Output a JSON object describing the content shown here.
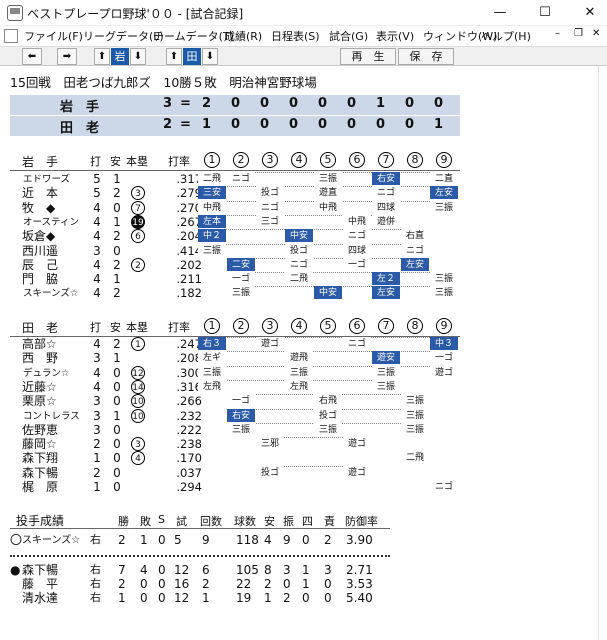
{
  "window": {
    "title": "ベストプレープロ野球'００ - [試合記録]",
    "controls": [
      "—",
      "☐",
      "✕"
    ]
  },
  "menu": [
    "ファイル(F)",
    "リーグデータ(L)",
    "チームデータ(T)",
    "成績(R)",
    "日程表(S)",
    "試合(G)",
    "表示(V)",
    "ウィンドウ(W)",
    "ヘルプ(H)"
  ],
  "toolbar": {
    "left": "⬅",
    "right": "➡",
    "home_up": "⬆",
    "home": "岩",
    "home_down": "⬇",
    "away_up": "⬆",
    "away": "田",
    "away_down": "⬇",
    "replay": "再　生",
    "save": "保　存"
  },
  "game": {
    "info": "15回戦　田老つば九郎ズ　10勝５敗　明治神宮野球場"
  },
  "scoreboard": [
    {
      "team": "岩　手",
      "runs": "3",
      "eq": "=",
      "innings": [
        "2",
        "0",
        "0",
        "0",
        "0",
        "0",
        "1",
        "0",
        "0"
      ]
    },
    {
      "team": "田　老",
      "runs": "2",
      "eq": "=",
      "innings": [
        "1",
        "0",
        "0",
        "0",
        "0",
        "0",
        "0",
        "0",
        "1"
      ]
    }
  ],
  "batting_headers": {
    "at_bat": "打",
    "hits": "安",
    "hr": "本塁",
    "avg": "打率",
    "innings": [
      "1",
      "2",
      "3",
      "4",
      "5",
      "6",
      "7",
      "8",
      "9"
    ]
  },
  "home_team": "岩　手",
  "home_batters": [
    {
      "name": "エドワーズ",
      "ab": "5",
      "h": "1",
      "hr": "",
      "avg": ".317",
      "ib": [
        [
          "二飛",
          0
        ],
        [
          "ニゴ",
          0
        ],
        [
          "",
          0
        ],
        [
          "",
          0
        ],
        [
          "三振",
          0
        ],
        [
          "",
          0
        ],
        [
          "右安",
          1
        ],
        [
          "",
          0
        ],
        [
          "二直",
          0
        ]
      ]
    },
    {
      "name": "近　本",
      "ab": "5",
      "h": "2",
      "hr": "3",
      "avg": ".279",
      "ib": [
        [
          "三安",
          1
        ],
        [
          "",
          0
        ],
        [
          "投ゴ",
          0
        ],
        [
          "",
          0
        ],
        [
          "遊直",
          0
        ],
        [
          "",
          0
        ],
        [
          "ニゴ",
          0
        ],
        [
          "",
          0
        ],
        [
          "左安",
          1
        ]
      ]
    },
    {
      "name": "牧　◆",
      "ab": "4",
      "h": "0",
      "hr": "7",
      "avg": ".270",
      "ib": [
        [
          "中飛",
          0
        ],
        [
          "",
          0
        ],
        [
          "ニゴ",
          0
        ],
        [
          "",
          0
        ],
        [
          "中飛",
          0
        ],
        [
          "",
          0
        ],
        [
          "四球",
          0
        ],
        [
          "",
          0
        ],
        [
          "三振",
          0
        ]
      ]
    },
    {
      "name": "オースティン",
      "ab": "4",
      "h": "1",
      "hr": "19",
      "hrsel": true,
      "avg": ".267",
      "ib": [
        [
          "左本",
          1
        ],
        [
          "",
          0
        ],
        [
          "三ゴ",
          0
        ],
        [
          "",
          0
        ],
        [
          "",
          0
        ],
        [
          "中飛",
          0
        ],
        [
          "遊併",
          0
        ],
        [
          "",
          0
        ],
        [
          "",
          0
        ]
      ]
    },
    {
      "name": "坂倉◆",
      "ab": "4",
      "h": "2",
      "hr": "6",
      "avg": ".204",
      "ib": [
        [
          "中２",
          1
        ],
        [
          "",
          0
        ],
        [
          "",
          0
        ],
        [
          "中安",
          1
        ],
        [
          "",
          0
        ],
        [
          "ニゴ",
          0
        ],
        [
          "",
          0
        ],
        [
          "右直",
          0
        ],
        [
          "",
          0
        ]
      ]
    },
    {
      "name": "西川遥",
      "ab": "3",
      "h": "0",
      "hr": "",
      "avg": ".414",
      "ib": [
        [
          "三振",
          0
        ],
        [
          "",
          0
        ],
        [
          "",
          0
        ],
        [
          "投ゴ",
          0
        ],
        [
          "",
          0
        ],
        [
          "四球",
          0
        ],
        [
          "",
          0
        ],
        [
          "ニゴ",
          0
        ],
        [
          "",
          0
        ]
      ]
    },
    {
      "name": "辰　己",
      "ab": "4",
      "h": "2",
      "hr": "2",
      "avg": ".202",
      "ib": [
        [
          "",
          0
        ],
        [
          "二安",
          1
        ],
        [
          "",
          0
        ],
        [
          "ニゴ",
          0
        ],
        [
          "",
          0
        ],
        [
          "一ゴ",
          0
        ],
        [
          "",
          0
        ],
        [
          "左安",
          1
        ],
        [
          "",
          0
        ]
      ]
    },
    {
      "name": "門　脇",
      "ab": "4",
      "h": "1",
      "hr": "",
      "avg": ".211",
      "ib": [
        [
          "",
          0
        ],
        [
          "一ゴ",
          0
        ],
        [
          "",
          0
        ],
        [
          "二飛",
          0
        ],
        [
          "",
          0
        ],
        [
          "",
          0
        ],
        [
          "左２",
          1
        ],
        [
          "",
          0
        ],
        [
          "三振",
          0
        ]
      ]
    },
    {
      "name": "スキーンズ☆",
      "ab": "4",
      "h": "2",
      "hr": "",
      "avg": ".182",
      "ib": [
        [
          "",
          0
        ],
        [
          "三振",
          0
        ],
        [
          "",
          0
        ],
        [
          "",
          0
        ],
        [
          "中安",
          1
        ],
        [
          "",
          0
        ],
        [
          "左安",
          1
        ],
        [
          "",
          0
        ],
        [
          "三振",
          0
        ]
      ]
    }
  ],
  "away_team": "田　老",
  "away_batters": [
    {
      "name": "高部☆",
      "ab": "4",
      "h": "2",
      "hr": "1",
      "avg": ".247",
      "ib": [
        [
          "右３",
          1
        ],
        [
          "",
          0
        ],
        [
          "遊ゴ",
          0
        ],
        [
          "",
          0
        ],
        [
          "",
          0
        ],
        [
          "ニゴ",
          0
        ],
        [
          "",
          0
        ],
        [
          "",
          0
        ],
        [
          "中３",
          1
        ]
      ]
    },
    {
      "name": "西　野",
      "ab": "3",
      "h": "1",
      "hr": "",
      "avg": ".208",
      "ib": [
        [
          "左ギ",
          0
        ],
        [
          "",
          0
        ],
        [
          "",
          0
        ],
        [
          "遊飛",
          0
        ],
        [
          "",
          0
        ],
        [
          "",
          0
        ],
        [
          "遊安",
          1
        ],
        [
          "",
          0
        ],
        [
          "一ゴ",
          0
        ]
      ]
    },
    {
      "name": "デュラン☆",
      "ab": "4",
      "h": "0",
      "hr": "12",
      "avg": ".300",
      "ib": [
        [
          "三振",
          0
        ],
        [
          "",
          0
        ],
        [
          "",
          0
        ],
        [
          "三振",
          0
        ],
        [
          "",
          0
        ],
        [
          "",
          0
        ],
        [
          "三振",
          0
        ],
        [
          "",
          0
        ],
        [
          "遊ゴ",
          0
        ]
      ]
    },
    {
      "name": "近藤☆",
      "ab": "4",
      "h": "0",
      "hr": "14",
      "avg": ".316",
      "ib": [
        [
          "左飛",
          0
        ],
        [
          "",
          0
        ],
        [
          "",
          0
        ],
        [
          "左飛",
          0
        ],
        [
          "",
          0
        ],
        [
          "",
          0
        ],
        [
          "三振",
          0
        ],
        [
          "",
          0
        ],
        [
          "",
          0
        ]
      ]
    },
    {
      "name": "栗原☆",
      "ab": "3",
      "h": "0",
      "hr": "10",
      "avg": ".266",
      "ib": [
        [
          "",
          0
        ],
        [
          "一ゴ",
          0
        ],
        [
          "",
          0
        ],
        [
          "",
          0
        ],
        [
          "右飛",
          0
        ],
        [
          "",
          0
        ],
        [
          "",
          0
        ],
        [
          "三振",
          0
        ],
        [
          "",
          0
        ]
      ]
    },
    {
      "name": "コントレラス",
      "ab": "3",
      "h": "1",
      "hr": "10",
      "avg": ".232",
      "ib": [
        [
          "",
          0
        ],
        [
          "右安",
          1
        ],
        [
          "",
          0
        ],
        [
          "",
          0
        ],
        [
          "投ゴ",
          0
        ],
        [
          "",
          0
        ],
        [
          "",
          0
        ],
        [
          "三振",
          0
        ],
        [
          "",
          0
        ]
      ]
    },
    {
      "name": "佐野恵",
      "ab": "3",
      "h": "0",
      "hr": "",
      "avg": ".222",
      "ib": [
        [
          "",
          0
        ],
        [
          "三振",
          0
        ],
        [
          "",
          0
        ],
        [
          "",
          0
        ],
        [
          "三振",
          0
        ],
        [
          "",
          0
        ],
        [
          "",
          0
        ],
        [
          "三振",
          0
        ],
        [
          "",
          0
        ]
      ]
    },
    {
      "name": "藤岡☆",
      "ab": "2",
      "h": "0",
      "hr": "3",
      "avg": ".238",
      "ib": [
        [
          "",
          0
        ],
        [
          "",
          0
        ],
        [
          "三邪",
          0
        ],
        [
          "",
          0
        ],
        [
          "",
          0
        ],
        [
          "遊ゴ",
          0
        ],
        [
          "",
          0
        ],
        [
          "",
          0
        ],
        [
          "",
          0
        ]
      ]
    },
    {
      "name": "森下翔",
      "ab": "1",
      "h": "0",
      "hr": "4",
      "avg": ".170",
      "ib": [
        [
          "",
          0
        ],
        [
          "",
          0
        ],
        [
          "",
          0
        ],
        [
          "",
          0
        ],
        [
          "",
          0
        ],
        [
          "",
          0
        ],
        [
          "",
          0
        ],
        [
          "二飛",
          0
        ],
        [
          "",
          0
        ]
      ]
    },
    {
      "name": "森下暢",
      "ab": "2",
      "h": "0",
      "hr": "",
      "avg": ".037",
      "ib": [
        [
          "",
          0
        ],
        [
          "",
          0
        ],
        [
          "投ゴ",
          0
        ],
        [
          "",
          0
        ],
        [
          "",
          0
        ],
        [
          "遊ゴ",
          0
        ],
        [
          "",
          0
        ],
        [
          "",
          0
        ],
        [
          "",
          0
        ]
      ]
    },
    {
      "name": "梶　原",
      "ab": "1",
      "h": "0",
      "hr": "",
      "avg": ".294",
      "ib": [
        [
          "",
          0
        ],
        [
          "",
          0
        ],
        [
          "",
          0
        ],
        [
          "",
          0
        ],
        [
          "",
          0
        ],
        [
          "",
          0
        ],
        [
          "",
          0
        ],
        [
          "",
          0
        ],
        [
          "ニゴ",
          0
        ]
      ]
    }
  ],
  "pitching": {
    "title": "投手成績",
    "headers": [
      "勝",
      "敗",
      "S",
      "試",
      "回数",
      "球数",
      "安",
      "振",
      "四",
      "責",
      "防御率"
    ],
    "home": [
      {
        "mark": "〇",
        "name": "スキーンズ☆",
        "hand": "右",
        "stats": [
          "2",
          "1",
          "0",
          "5",
          "9",
          "118",
          "4",
          "9",
          "0",
          "2",
          "3.90"
        ]
      }
    ],
    "away": [
      {
        "mark": "●",
        "name": "森下暢",
        "hand": "右",
        "stats": [
          "7",
          "4",
          "0",
          "12",
          "6",
          "105",
          "8",
          "3",
          "1",
          "3",
          "2.71"
        ]
      },
      {
        "mark": "",
        "name": "藤　平",
        "hand": "右",
        "stats": [
          "2",
          "0",
          "0",
          "16",
          "2",
          "22",
          "2",
          "0",
          "1",
          "0",
          "3.53"
        ]
      },
      {
        "mark": "",
        "name": "清水達",
        "hand": "右",
        "stats": [
          "1",
          "0",
          "0",
          "12",
          "1",
          "19",
          "1",
          "2",
          "0",
          "0",
          "5.40"
        ]
      }
    ]
  }
}
